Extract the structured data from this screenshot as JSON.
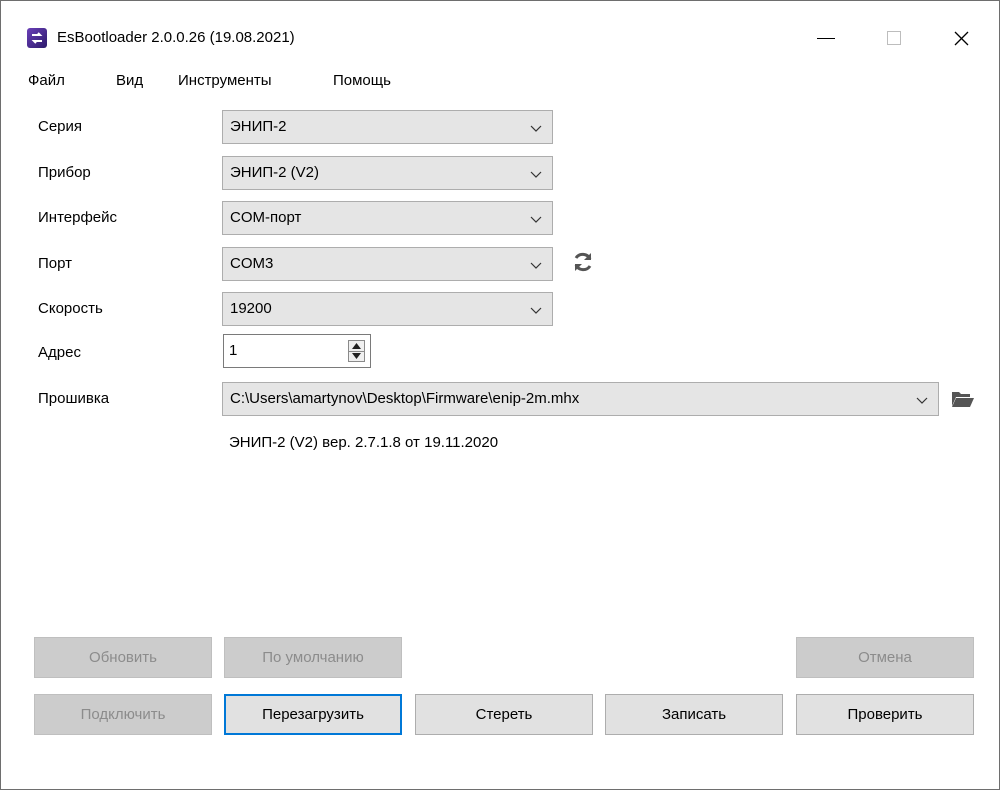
{
  "window": {
    "title": "EsBootloader 2.0.0.26 (19.08.2021)",
    "accent": "#0078d7"
  },
  "menu": {
    "file": "Файл",
    "view": "Вид",
    "tools": "Инструменты",
    "help": "Помощь"
  },
  "form": {
    "series": {
      "label": "Серия",
      "value": "ЭНИП-2"
    },
    "device": {
      "label": "Прибор",
      "value": "ЭНИП-2 (V2)"
    },
    "interface": {
      "label": "Интерфейс",
      "value": "COM-порт"
    },
    "port": {
      "label": "Порт",
      "value": "COM3"
    },
    "speed": {
      "label": "Скорость",
      "value": "19200"
    },
    "address": {
      "label": "Адрес",
      "value": "1"
    },
    "firmware": {
      "label": "Прошивка",
      "value": "C:\\Users\\amartynov\\Desktop\\Firmware\\enip-2m.mhx"
    },
    "firmware_info": "ЭНИП-2 (V2) вер. 2.7.1.8 от 19.11.2020"
  },
  "buttons": {
    "update": "Обновить",
    "defaults": "По умолчанию",
    "cancel": "Отмена",
    "connect": "Подключить",
    "reboot": "Перезагрузить",
    "erase": "Стереть",
    "write": "Записать",
    "verify": "Проверить"
  },
  "icons": {
    "app": "app-logo-icon",
    "refresh": "refresh-icon",
    "folder": "folder-open-icon",
    "chevron": "chevron-down-icon"
  }
}
